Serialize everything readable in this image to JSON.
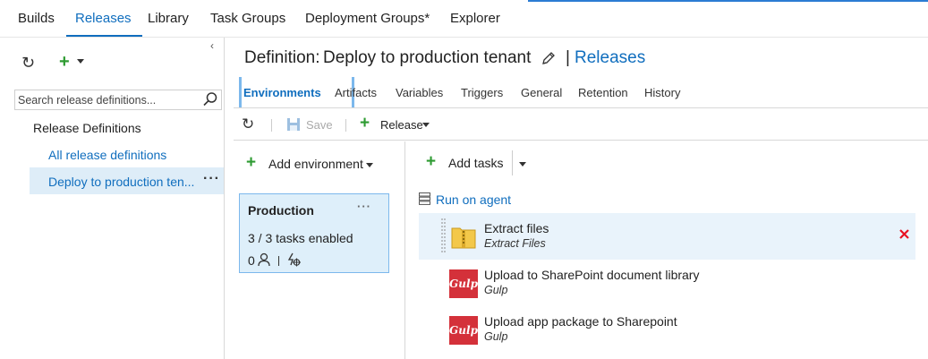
{
  "nav": {
    "tabs": [
      {
        "label": "Builds"
      },
      {
        "label": "Releases"
      },
      {
        "label": "Library"
      },
      {
        "label": "Task Groups"
      },
      {
        "label": "Deployment Groups*"
      },
      {
        "label": "Explorer"
      }
    ],
    "active_tab": "Releases"
  },
  "sidebar": {
    "search_placeholder": "Search release definitions...",
    "section_title": "Release Definitions",
    "items": [
      {
        "label": "All release definitions"
      },
      {
        "label": "Deploy to production ten..."
      }
    ]
  },
  "header": {
    "definition_label": "Definition:",
    "definition_name": "Deploy to production tenant",
    "separator": "|",
    "releases_link": "Releases"
  },
  "subtabs": [
    {
      "label": "Environments"
    },
    {
      "label": "Artifacts"
    },
    {
      "label": "Variables"
    },
    {
      "label": "Triggers"
    },
    {
      "label": "General"
    },
    {
      "label": "Retention"
    },
    {
      "label": "History"
    }
  ],
  "toolbar": {
    "save_label": "Save",
    "release_label": "Release"
  },
  "environments": {
    "add_label": "Add environment",
    "cards": [
      {
        "name": "Production",
        "tasks_enabled": "3 / 3 tasks enabled",
        "approvals": "0"
      }
    ]
  },
  "tasks": {
    "add_label": "Add tasks",
    "phase_label": "Run on agent",
    "items": [
      {
        "title": "Extract files",
        "subtitle": "Extract Files",
        "icon": "zip-folder-icon"
      },
      {
        "title": "Upload to SharePoint document library",
        "subtitle": "Gulp",
        "icon": "gulp-icon",
        "icon_text": "Gulp"
      },
      {
        "title": "Upload app package to Sharepoint",
        "subtitle": "Gulp",
        "icon": "gulp-icon",
        "icon_text": "Gulp"
      }
    ]
  },
  "colors": {
    "accent": "#106ebe",
    "add_green": "#2e9b32",
    "delete_red": "#e81123",
    "gulp_red": "#d4313a",
    "selected_bg": "#deedf8"
  }
}
